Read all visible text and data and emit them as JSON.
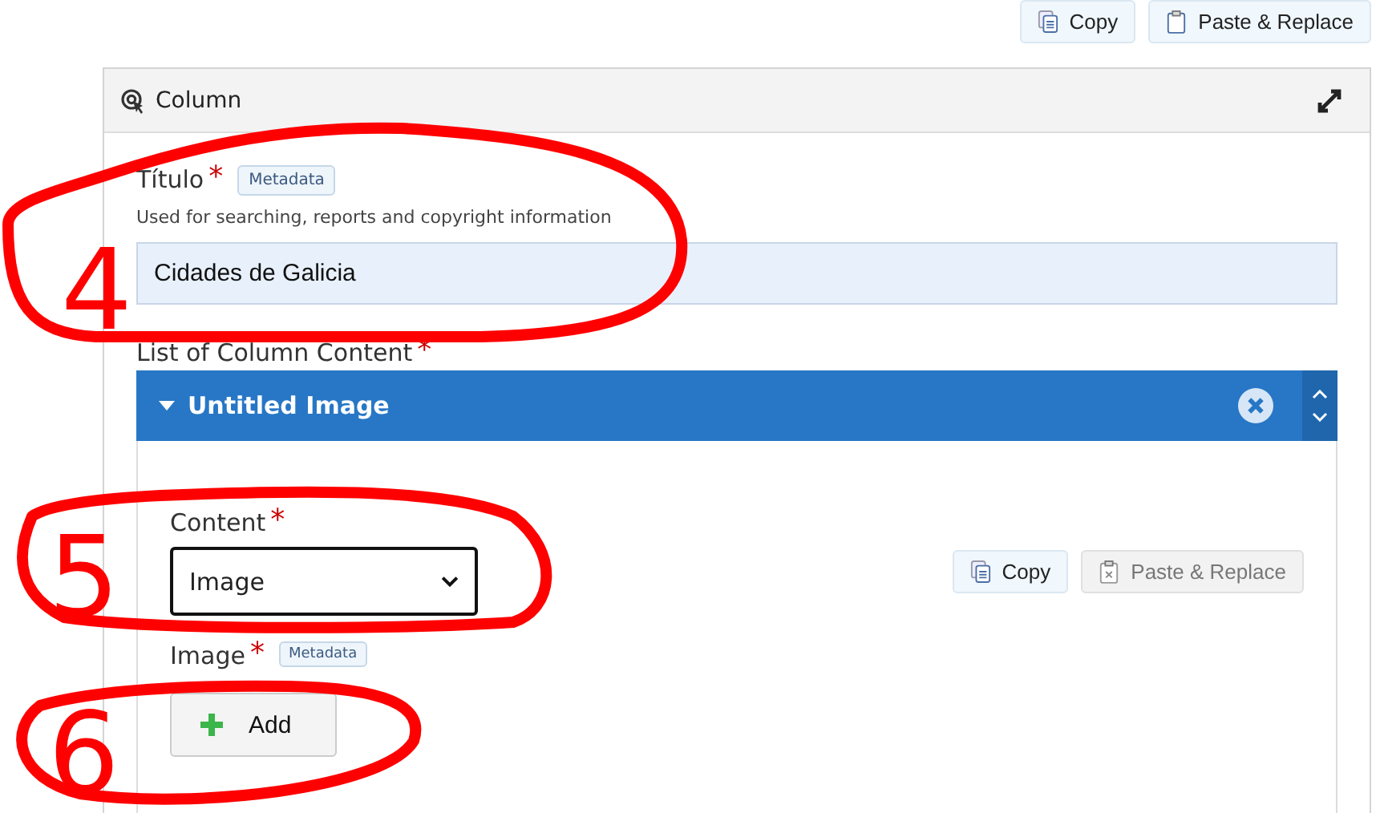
{
  "top_actions": [
    {
      "label": "Copy",
      "kind": "copy",
      "disabled": false
    },
    {
      "label": "Paste & Replace",
      "kind": "paste",
      "disabled": false
    }
  ],
  "panel": {
    "title": "Column",
    "fields": [
      {
        "label": "Título",
        "required": true,
        "required_mark": "*",
        "badge": "Metadata",
        "help": "Used for searching, reports and copyright information",
        "value": "Cidades de Galicia"
      }
    ],
    "list": {
      "label": "List of Column Content",
      "required": true,
      "required_mark": "*",
      "item": {
        "title": "Untitled Image",
        "expanded": true,
        "content": {
          "label": "Content",
          "required": true,
          "required_mark": "*",
          "value": "Image"
        },
        "actions": [
          {
            "label": "Copy",
            "kind": "copy",
            "disabled": false
          },
          {
            "label": "Paste & Replace",
            "kind": "paste",
            "disabled": true
          }
        ],
        "image": {
          "label": "Image",
          "required": true,
          "required_mark": "*",
          "badge": "Metadata",
          "button": "Add"
        }
      }
    }
  },
  "annotations": [
    {
      "label": "4"
    },
    {
      "label": "5"
    },
    {
      "label": "6"
    }
  ]
}
